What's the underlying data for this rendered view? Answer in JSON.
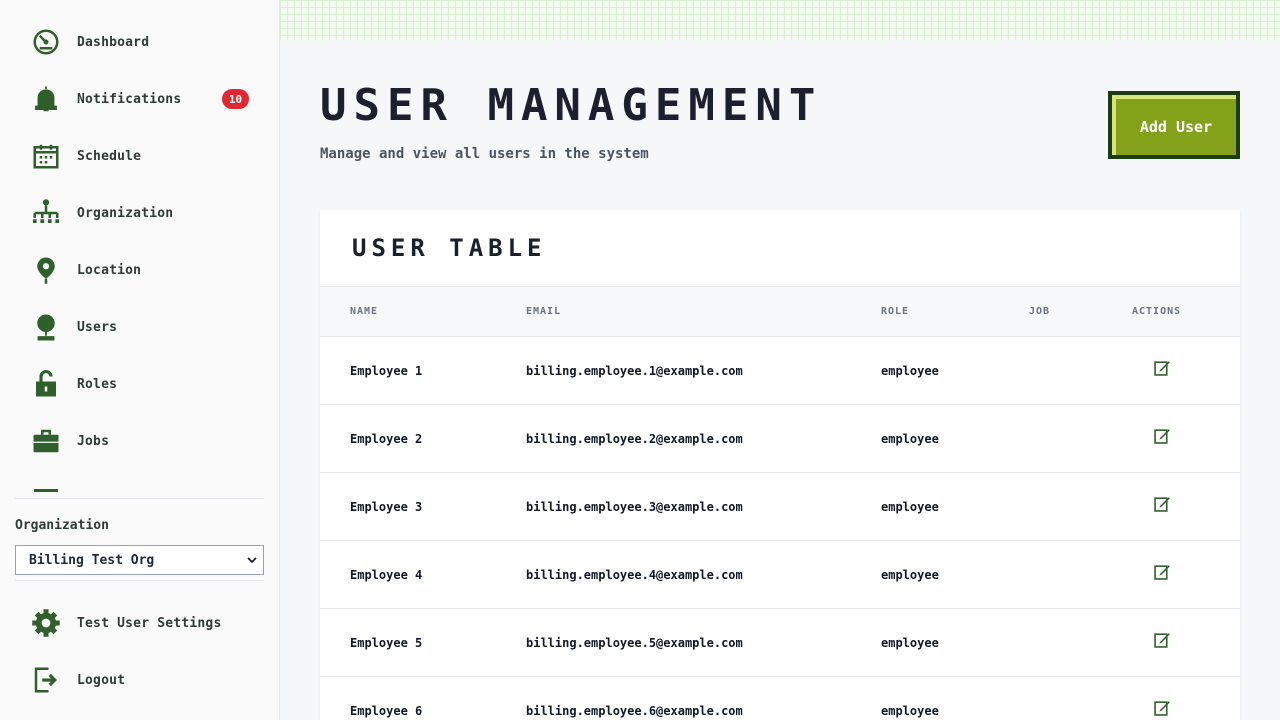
{
  "sidebar": {
    "nav": [
      {
        "label": "Dashboard",
        "icon": "dashboard-icon"
      },
      {
        "label": "Notifications",
        "icon": "bell-icon",
        "badge": "10"
      },
      {
        "label": "Schedule",
        "icon": "calendar-icon"
      },
      {
        "label": "Organization",
        "icon": "org-chart-icon"
      },
      {
        "label": "Location",
        "icon": "location-pin-icon"
      },
      {
        "label": "Users",
        "icon": "user-icon"
      },
      {
        "label": "Roles",
        "icon": "lock-icon"
      },
      {
        "label": "Jobs",
        "icon": "briefcase-icon"
      }
    ],
    "organization_label": "Organization",
    "organization_selected": "Billing Test Org",
    "footer": [
      {
        "label": "Test User Settings",
        "icon": "gear-icon"
      },
      {
        "label": "Logout",
        "icon": "logout-icon"
      }
    ]
  },
  "header": {
    "title": "User Management",
    "subtitle": "Manage and view all users in the system",
    "add_button": "Add User"
  },
  "table": {
    "title": "User Table",
    "columns": [
      "Name",
      "Email",
      "Role",
      "Job",
      "Actions"
    ],
    "rows": [
      {
        "name": "Employee 1",
        "email": "billing.employee.1@example.com",
        "role": "employee",
        "job": ""
      },
      {
        "name": "Employee 2",
        "email": "billing.employee.2@example.com",
        "role": "employee",
        "job": ""
      },
      {
        "name": "Employee 3",
        "email": "billing.employee.3@example.com",
        "role": "employee",
        "job": ""
      },
      {
        "name": "Employee 4",
        "email": "billing.employee.4@example.com",
        "role": "employee",
        "job": ""
      },
      {
        "name": "Employee 5",
        "email": "billing.employee.5@example.com",
        "role": "employee",
        "job": ""
      },
      {
        "name": "Employee 6",
        "email": "billing.employee.6@example.com",
        "role": "employee",
        "job": ""
      }
    ]
  },
  "colors": {
    "accent": "#84a11a",
    "accent_dark": "#1c3d12",
    "icon": "#2f5f2a",
    "badge": "#e5252f"
  }
}
